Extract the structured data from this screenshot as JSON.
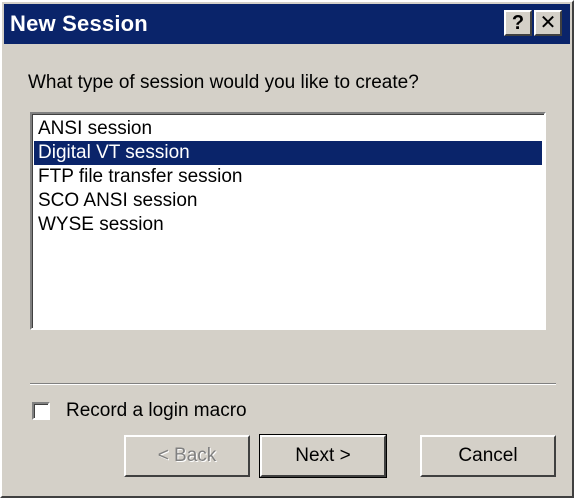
{
  "window": {
    "title": "New Session",
    "help_glyph": "?",
    "close_glyph": "✕"
  },
  "dialog": {
    "prompt": "What type of session would you like to create?",
    "session_types": [
      {
        "label": "ANSI session",
        "selected": false
      },
      {
        "label": "Digital VT session",
        "selected": true
      },
      {
        "label": "FTP file transfer session",
        "selected": false
      },
      {
        "label": "SCO ANSI session",
        "selected": false
      },
      {
        "label": "WYSE session",
        "selected": false
      }
    ],
    "record_macro_label": "Record a login macro",
    "record_macro_checked": false
  },
  "buttons": {
    "back_label": "< Back",
    "back_enabled": false,
    "next_label": "Next >",
    "cancel_label": "Cancel"
  },
  "colors": {
    "titlebar": "#0a246a",
    "selection": "#0a246a",
    "face": "#d4d0c8"
  }
}
